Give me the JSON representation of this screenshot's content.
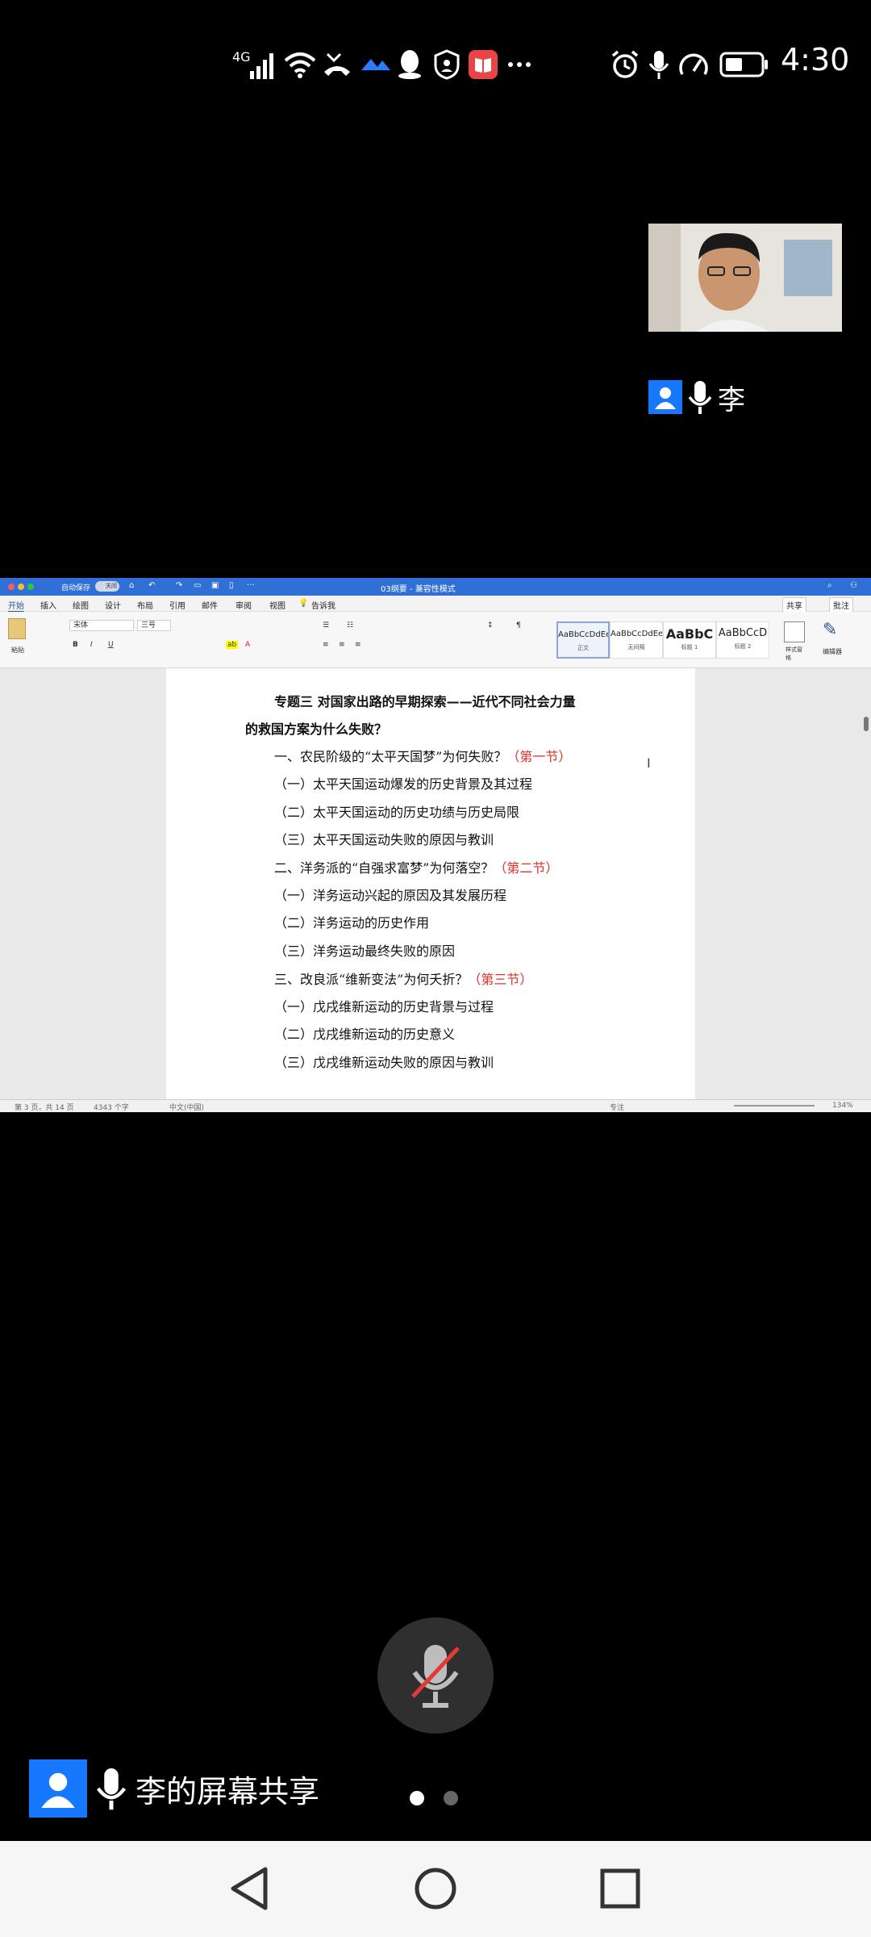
{
  "status_bar": {
    "network": "4G",
    "time": "4:30",
    "icons": [
      "signal-icon",
      "wifi-icon",
      "missed-call-icon",
      "app-icon",
      "qq-icon",
      "shield-icon",
      "book-icon",
      "more-icon",
      "alarm-icon",
      "mic-icon",
      "speed-icon",
      "battery-icon"
    ]
  },
  "remote_video": {
    "participant_name": "李"
  },
  "shared_screen": {
    "window": {
      "autosave_label": "自动保存",
      "autosave_state": "关闭",
      "document_title": "03纲要 - 兼容性模式"
    },
    "menu_tabs": [
      "开始",
      "插入",
      "绘图",
      "设计",
      "布局",
      "引用",
      "邮件",
      "审阅",
      "视图",
      "告诉我"
    ],
    "menu_right": {
      "share": "共享",
      "comment": "批注"
    },
    "ribbon": {
      "paste_label": "粘贴",
      "font_name": "宋体",
      "font_size": "三号",
      "styles": [
        {
          "sample": "AaBbCcDdEe",
          "name": "正文"
        },
        {
          "sample": "AaBbCcDdEe",
          "name": "无间隔"
        },
        {
          "sample": "AaBbC",
          "name": "标题 1"
        },
        {
          "sample": "AaBbCcD",
          "name": "标题 2"
        }
      ],
      "styles_pane_label": "样式窗格",
      "editor_label": "编辑器"
    },
    "document": {
      "title_line1": "专题三  对国家出路的早期探索——近代不同社会力量",
      "title_line2": "的救国方案为什么失败？",
      "lines": [
        {
          "text": "一、农民阶级的“太平天国梦”为何失败？",
          "note": "（第一节）"
        },
        {
          "text": "（一）太平天国运动爆发的历史背景及其过程",
          "note": ""
        },
        {
          "text": "（二）太平天国运动的历史功绩与历史局限",
          "note": ""
        },
        {
          "text": "（三）太平天国运动失败的原因与教训",
          "note": ""
        },
        {
          "text": "二、洋务派的“自强求富梦”为何落空？",
          "note": "（第二节）"
        },
        {
          "text": "（一）洋务运动兴起的原因及其发展历程",
          "note": ""
        },
        {
          "text": "（二）洋务运动的历史作用",
          "note": ""
        },
        {
          "text": "（三）洋务运动最终失败的原因",
          "note": ""
        },
        {
          "text": "三、改良派“维新变法”为何夭折？",
          "note": "（第三节）"
        },
        {
          "text": "（一）戊戌维新运动的历史背景与过程",
          "note": ""
        },
        {
          "text": "（二）戊戌维新运动的历史意义",
          "note": ""
        },
        {
          "text": "（三）戊戌维新运动失败的原因与教训",
          "note": ""
        }
      ]
    },
    "statusbar": {
      "page": "第 3 页，共 14 页",
      "words": "4343 个字",
      "language": "中文(中国)",
      "focus": "专注",
      "zoom": "134%"
    }
  },
  "bottom": {
    "share_label": "李的屏幕共享",
    "mic_state": "muted",
    "page_dots": 2,
    "active_dot": 0
  },
  "nav": {
    "buttons": [
      "back-icon",
      "home-icon",
      "recents-icon"
    ]
  }
}
